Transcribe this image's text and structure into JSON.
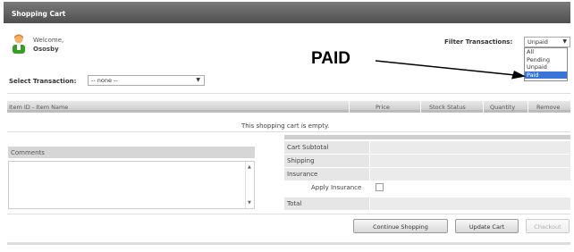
{
  "window": {
    "title": "Shopping Cart"
  },
  "user": {
    "welcome": "Welcome,",
    "name": "Ososby"
  },
  "filter": {
    "label": "Filter Transactions:",
    "selected": "Unpaid",
    "options": [
      "All",
      "Pending",
      "Unpaid",
      "Paid"
    ],
    "highlighted": "Paid"
  },
  "annotation": {
    "text": "PAID"
  },
  "transaction": {
    "label": "Select Transaction:",
    "selected": "-- none --"
  },
  "table": {
    "columns": [
      "Item ID - Item Name",
      "Price",
      "Stock Status",
      "Quantity",
      "Remove"
    ],
    "empty_message": "This shopping cart is empty."
  },
  "comments": {
    "label": "Comments",
    "value": ""
  },
  "totals": {
    "subtotal": "Cart Subtotal",
    "shipping": "Shipping",
    "insurance": "Insurance",
    "apply_insurance": "Apply Insurance",
    "total": "Total"
  },
  "buttons": {
    "continue": "Continue Shopping",
    "update": "Update Cart",
    "checkout": "Checkout"
  },
  "colors": {
    "accent": "#3875d7",
    "titlebar": "#5a5a5a"
  }
}
